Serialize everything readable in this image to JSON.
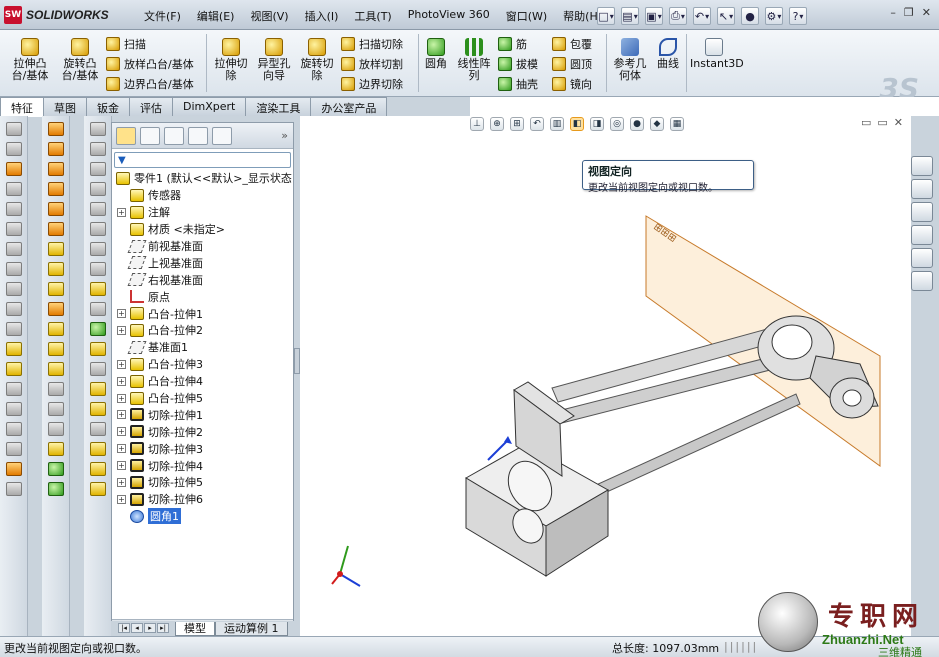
{
  "app": {
    "logo_text": "SW",
    "brand": "SOLIDWORKS"
  },
  "menu": [
    "文件(F)",
    "编辑(E)",
    "视图(V)",
    "插入(I)",
    "工具(T)",
    "PhotoView 360",
    "窗口(W)",
    "帮助(H)"
  ],
  "ribbon": {
    "extrude_boss": "拉伸凸台/基体",
    "revolve_boss": "旋转凸台/基体",
    "sweep": "扫描",
    "loft": "放样凸台/基体",
    "boundary_boss": "边界凸台/基体",
    "extrude_cut": "拉伸切除",
    "hole_wizard": "异型孔向导",
    "revolve_cut": "旋转切除",
    "swept_cut": "扫描切除",
    "lofted_cut": "放样切割",
    "boundary_cut": "边界切除",
    "fillet": "圆角",
    "linear_pattern": "线性阵列",
    "rib": "筋",
    "draft": "拔模",
    "shell": "抽壳",
    "wrap": "包覆",
    "dome": "圆顶",
    "mirror": "镜向",
    "ref_geometry": "参考几何体",
    "curves": "曲线",
    "instant3d": "Instant3D"
  },
  "tabs": [
    "特征",
    "草图",
    "钣金",
    "评估",
    "DimXpert",
    "渲染工具",
    "办公室产品"
  ],
  "tree": [
    {
      "label": "零件1  (默认<<默认>_显示状态",
      "icon": "part-icon",
      "pm": ""
    },
    {
      "label": "传感器",
      "icon": "sensor-icon",
      "pm": ""
    },
    {
      "label": "注解",
      "icon": "annotation-icon",
      "pm": "+"
    },
    {
      "label": "材质 <未指定>",
      "icon": "material-icon",
      "pm": ""
    },
    {
      "label": "前视基准面",
      "icon": "plane-icon",
      "pm": ""
    },
    {
      "label": "上视基准面",
      "icon": "plane-icon",
      "pm": ""
    },
    {
      "label": "右视基准面",
      "icon": "plane-icon",
      "pm": ""
    },
    {
      "label": "原点",
      "icon": "origin-icon",
      "pm": ""
    },
    {
      "label": "凸台-拉伸1",
      "icon": "boss-icon",
      "pm": "+"
    },
    {
      "label": "凸台-拉伸2",
      "icon": "boss-icon",
      "pm": "+"
    },
    {
      "label": "基准面1",
      "icon": "plane-icon",
      "pm": ""
    },
    {
      "label": "凸台-拉伸3",
      "icon": "boss-icon",
      "pm": "+"
    },
    {
      "label": "凸台-拉伸4",
      "icon": "boss-icon",
      "pm": "+"
    },
    {
      "label": "凸台-拉伸5",
      "icon": "boss-icon",
      "pm": "+"
    },
    {
      "label": "切除-拉伸1",
      "icon": "cut-icon",
      "pm": "+"
    },
    {
      "label": "切除-拉伸2",
      "icon": "cut-icon",
      "pm": "+"
    },
    {
      "label": "切除-拉伸3",
      "icon": "cut-icon",
      "pm": "+"
    },
    {
      "label": "切除-拉伸4",
      "icon": "cut-icon",
      "pm": "+"
    },
    {
      "label": "切除-拉伸5",
      "icon": "cut-icon",
      "pm": "+"
    },
    {
      "label": "切除-拉伸6",
      "icon": "cut-icon",
      "pm": "+"
    },
    {
      "label": "圆角1",
      "icon": "fillet-icon",
      "pm": "",
      "selected": true
    }
  ],
  "tooltip": {
    "title": "视图定向",
    "desc": "更改当前视图定向或视口数。"
  },
  "bottom_tabs": [
    "模型",
    "运动算例 1"
  ],
  "status": {
    "message": "更改当前视图定向或视口数。",
    "length": "总长度:  1097.03mm"
  },
  "watermark": {
    "cn": "专职网",
    "en": "Zhuanzhi.Net",
    "sub": "三维精通"
  },
  "colors": {
    "accent": "#2f6ed6",
    "plane": "#f7c98a",
    "brand_red": "#c8102e"
  }
}
